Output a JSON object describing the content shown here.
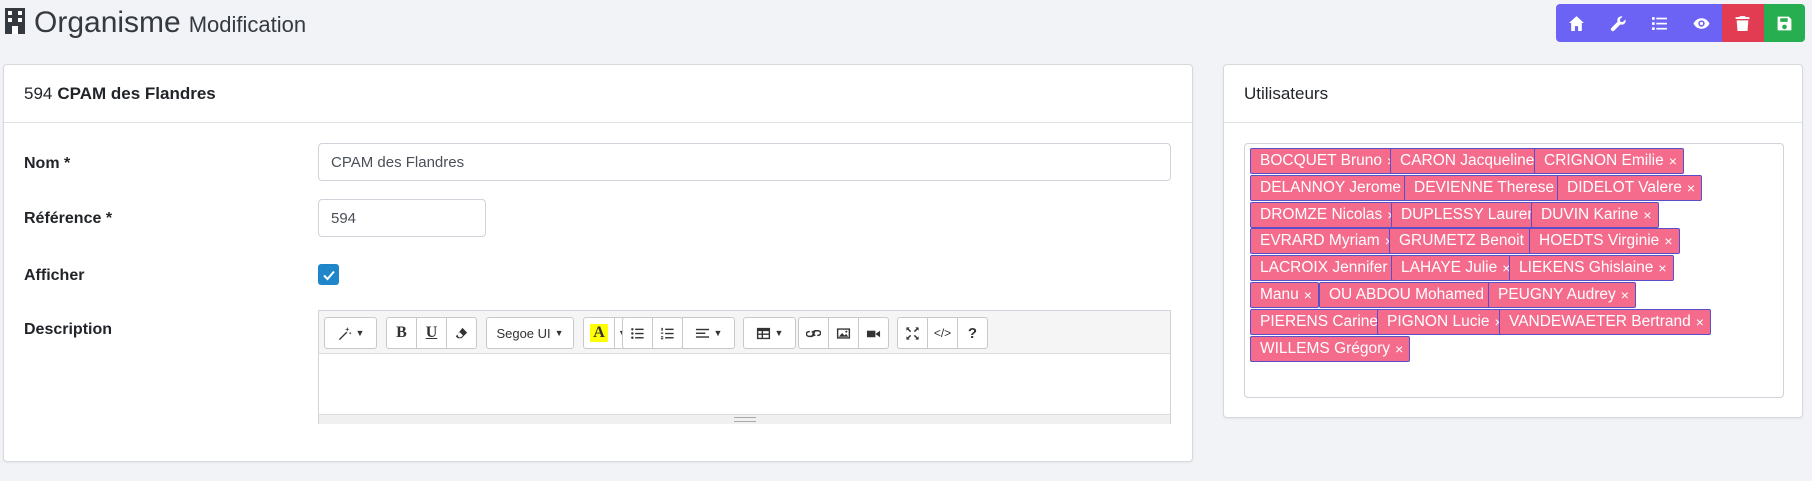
{
  "header": {
    "title": "Organisme",
    "subtitle": "Modification",
    "icon": "building-icon"
  },
  "toolbar": {
    "buttons": [
      {
        "name": "home-button",
        "icon": "home-icon",
        "color": "#6c63f5"
      },
      {
        "name": "settings-button",
        "icon": "wrench-icon",
        "color": "#6c63f5"
      },
      {
        "name": "list-button",
        "icon": "list-icon",
        "color": "#6c63f5"
      },
      {
        "name": "view-button",
        "icon": "eye-icon",
        "color": "#6c63f5"
      },
      {
        "name": "delete-button",
        "icon": "trash-icon",
        "color": "#e23c53"
      },
      {
        "name": "save-button",
        "icon": "save-icon",
        "color": "#27ae50"
      }
    ]
  },
  "form": {
    "card_id": "594",
    "card_name": "CPAM des Flandres",
    "nom_label": "Nom *",
    "nom_value": "CPAM des Flandres",
    "reference_label": "Référence *",
    "reference_value": "594",
    "afficher_label": "Afficher",
    "afficher_checked": true,
    "description_label": "Description",
    "editor": {
      "font_name": "Segoe UI",
      "highlight_color": "#ffff00"
    }
  },
  "users": {
    "title": "Utilisateurs",
    "remove_symbol": "×",
    "tag_color": "#f56b8c",
    "tags": [
      "BOCQUET Bruno",
      "CARON Jacqueline",
      "CRIGNON Emilie",
      "DELANNOY Jerome",
      "DEVIENNE Therese",
      "DIDELOT Valere",
      "DROMZE Nicolas",
      "DUPLESSY Laurent",
      "DUVIN Karine",
      "EVRARD Myriam",
      "GRUMETZ Benoit",
      "HOEDTS Virginie",
      "LACROIX Jennifer",
      "LAHAYE Julie",
      "LIEKENS Ghislaine",
      "Manu",
      "OU ABDOU Mohamed",
      "PEUGNY Audrey",
      "PIERENS Carine",
      "PIGNON Lucie",
      "VANDEWAETER Bertrand",
      "WILLEMS Grégory"
    ]
  }
}
